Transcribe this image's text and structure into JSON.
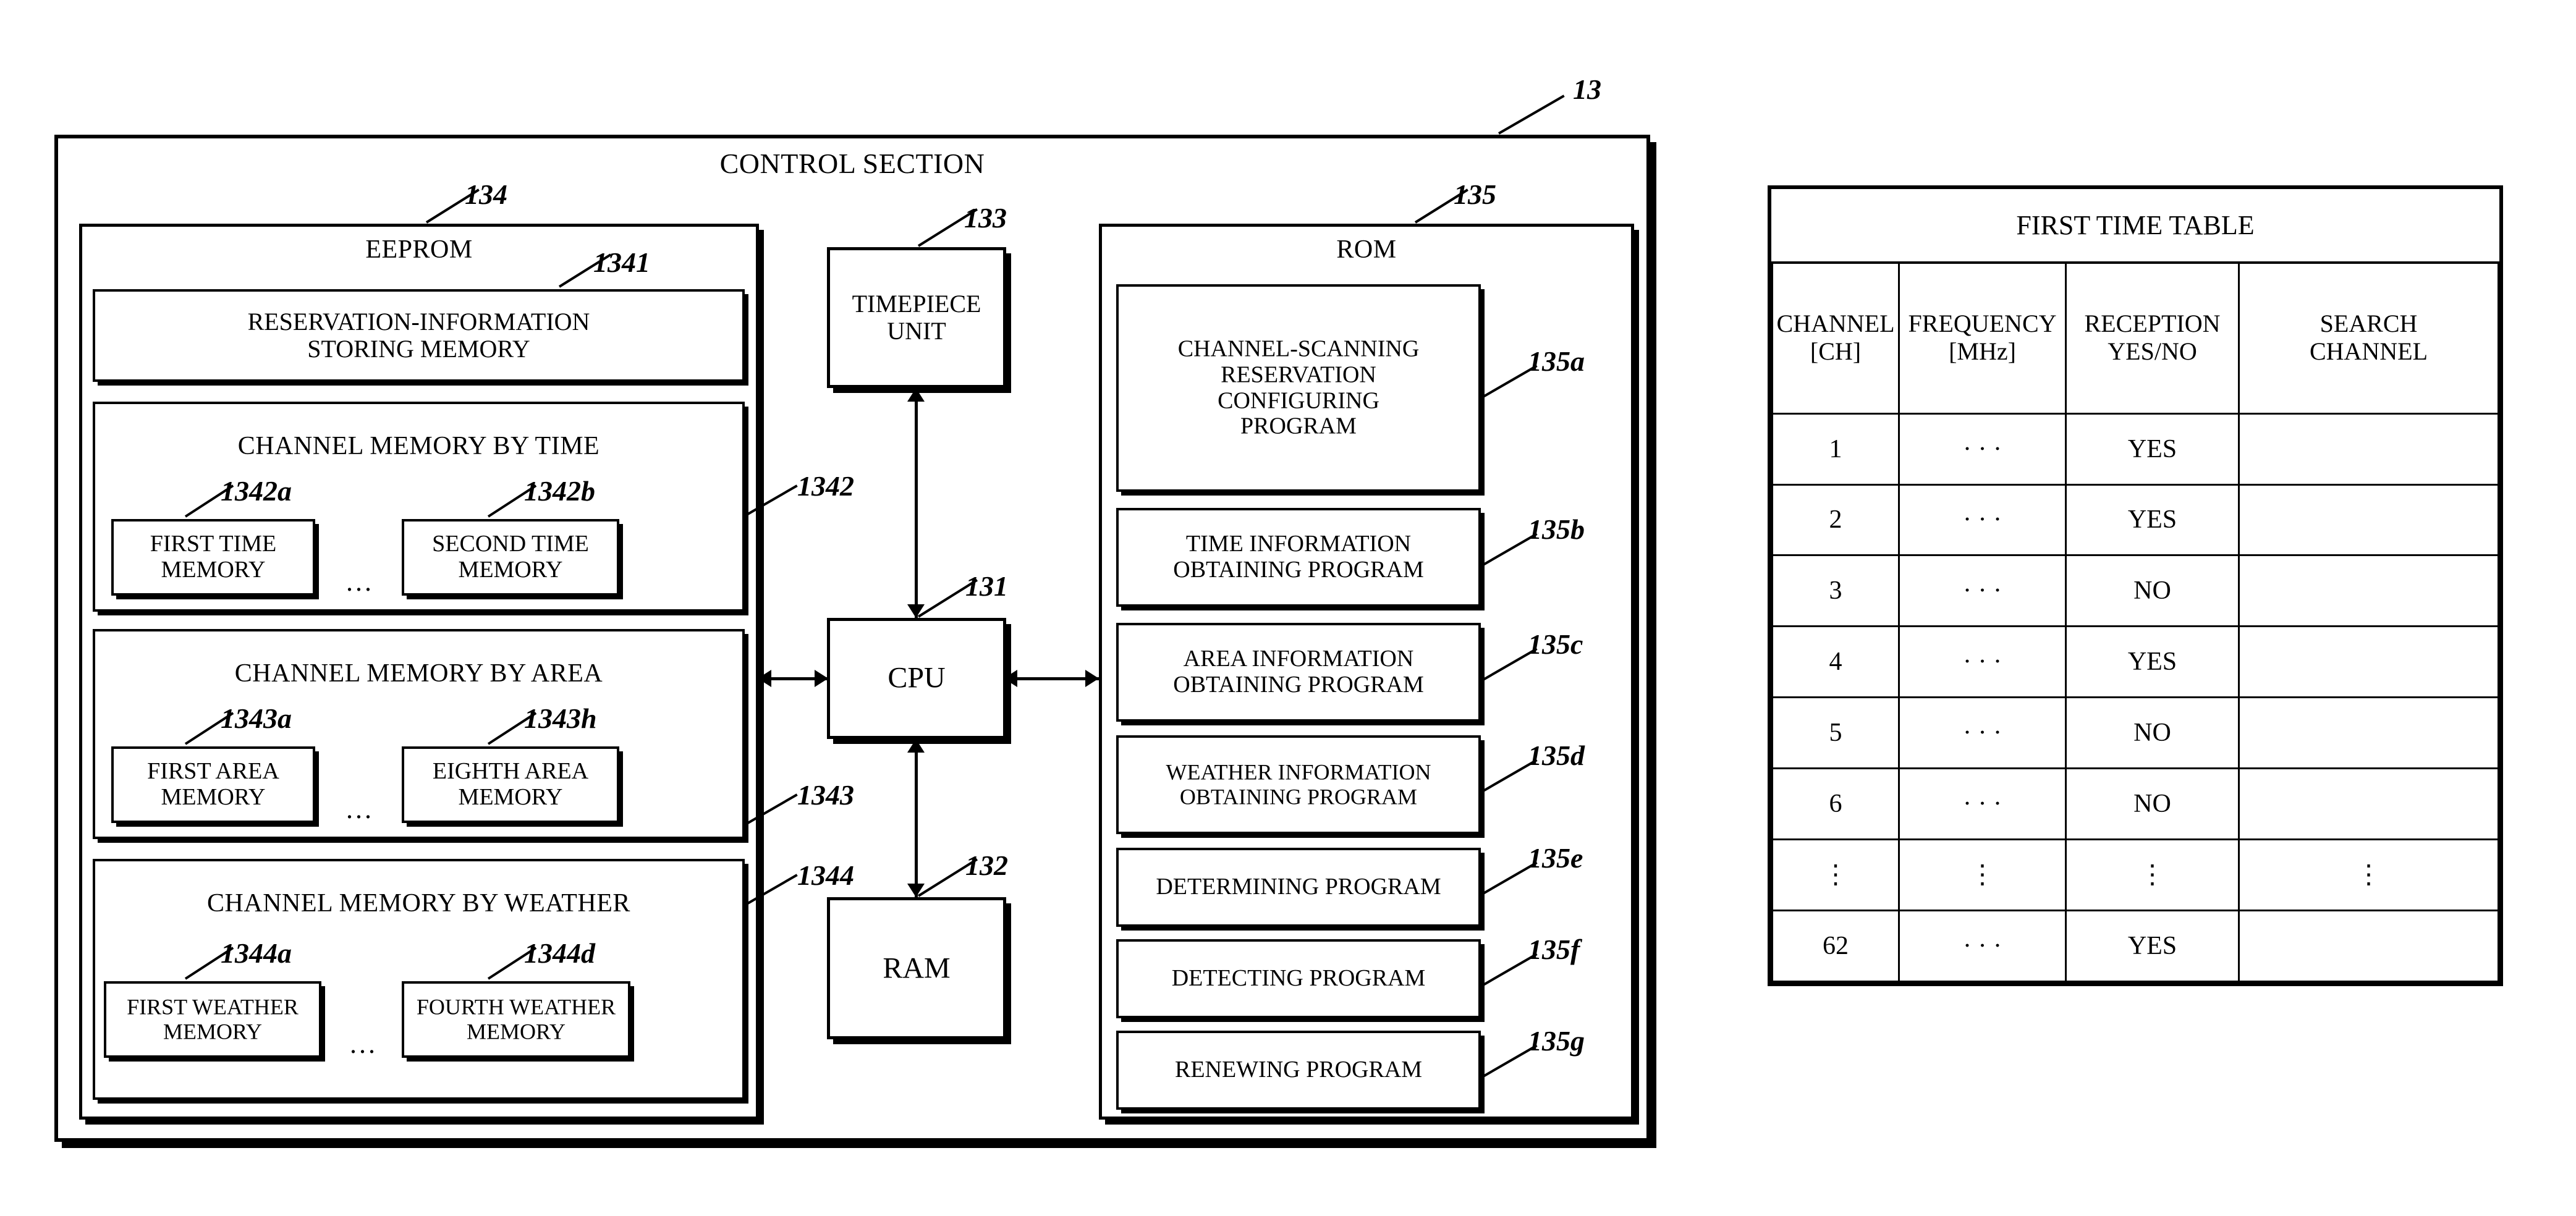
{
  "figure": {
    "control_section": {
      "title": "CONTROL SECTION",
      "ref": "13"
    },
    "eeprom": {
      "title": "EEPROM",
      "ref": "134",
      "reservation_memory": {
        "label": "RESERVATION-INFORMATION STORING MEMORY",
        "line1": "RESERVATION-INFORMATION",
        "line2": "STORING MEMORY",
        "ref": "1341"
      },
      "channel_memory_by_time": {
        "title": "CHANNEL MEMORY BY TIME",
        "ref": "1342",
        "ellipsis": "...",
        "first": {
          "line1": "FIRST TIME",
          "line2": "MEMORY",
          "ref": "1342a"
        },
        "second": {
          "line1": "SECOND TIME",
          "line2": "MEMORY",
          "ref": "1342b"
        }
      },
      "channel_memory_by_area": {
        "title": "CHANNEL MEMORY BY AREA",
        "ref": "1343",
        "ellipsis": "...",
        "first": {
          "line1": "FIRST AREA",
          "line2": "MEMORY",
          "ref": "1343a"
        },
        "eighth": {
          "line1": "EIGHTH AREA",
          "line2": "MEMORY",
          "ref": "1343h"
        }
      },
      "channel_memory_by_weather": {
        "title": "CHANNEL MEMORY BY WEATHER",
        "ref": "1344",
        "ellipsis": "...",
        "first": {
          "line1": "FIRST WEATHER",
          "line2": "MEMORY",
          "ref": "1344a"
        },
        "fourth": {
          "line1": "FOURTH WEATHER",
          "line2": "MEMORY",
          "ref": "1344d"
        }
      }
    },
    "timepiece_unit": {
      "line1": "TIMEPIECE",
      "line2": "UNIT",
      "ref": "133"
    },
    "cpu": {
      "label": "CPU",
      "ref": "131"
    },
    "ram": {
      "label": "RAM",
      "ref": "132"
    },
    "rom": {
      "title": "ROM",
      "ref": "135",
      "programs": [
        {
          "lines": [
            "CHANNEL-SCANNING",
            "RESERVATION",
            "CONFIGURING",
            "PROGRAM"
          ],
          "ref": "135a"
        },
        {
          "lines": [
            "TIME INFORMATION",
            "OBTAINING PROGRAM"
          ],
          "ref": "135b"
        },
        {
          "lines": [
            "AREA INFORMATION",
            "OBTAINING PROGRAM"
          ],
          "ref": "135c"
        },
        {
          "lines": [
            "WEATHER INFORMATION",
            "OBTAINING PROGRAM"
          ],
          "ref": "135d"
        },
        {
          "lines": [
            "DETERMINING PROGRAM"
          ],
          "ref": "135e"
        },
        {
          "lines": [
            "DETECTING PROGRAM"
          ],
          "ref": "135f"
        },
        {
          "lines": [
            "RENEWING PROGRAM"
          ],
          "ref": "135g"
        }
      ]
    }
  },
  "first_time_table": {
    "caption": "FIRST TIME TABLE",
    "headers": [
      {
        "line1": "CHANNEL",
        "line2": "[CH]"
      },
      {
        "line1": "FREQUENCY",
        "line2": "[MHz]"
      },
      {
        "line1": "RECEPTION",
        "line2": "YES/NO"
      },
      {
        "line1": "SEARCH",
        "line2": "CHANNEL"
      }
    ],
    "rows": [
      {
        "channel": "1",
        "frequency": "· · ·",
        "reception": "YES",
        "search": ""
      },
      {
        "channel": "2",
        "frequency": "· · ·",
        "reception": "YES",
        "search": ""
      },
      {
        "channel": "3",
        "frequency": "· · ·",
        "reception": "NO",
        "search": ""
      },
      {
        "channel": "4",
        "frequency": "· · ·",
        "reception": "YES",
        "search": ""
      },
      {
        "channel": "5",
        "frequency": "· · ·",
        "reception": "NO",
        "search": ""
      },
      {
        "channel": "6",
        "frequency": "· · ·",
        "reception": "NO",
        "search": ""
      },
      {
        "channel": "⋮",
        "frequency": "⋮",
        "reception": "⋮",
        "search": "⋮",
        "is_ellipsis": true
      },
      {
        "channel": "62",
        "frequency": "· · ·",
        "reception": "YES",
        "search": ""
      }
    ]
  },
  "colors": {
    "ink": "#000000",
    "paper": "#ffffff"
  }
}
